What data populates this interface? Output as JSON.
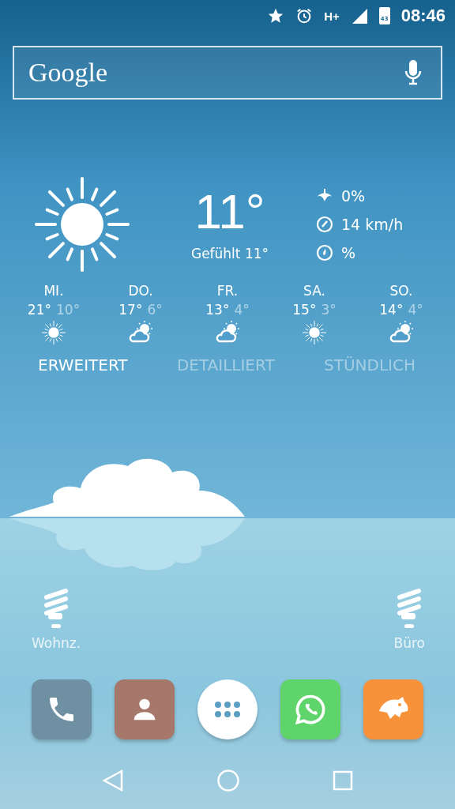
{
  "status_bar": {
    "network": "H+",
    "battery": "43",
    "time": "08:46"
  },
  "search": {
    "logo": "Google"
  },
  "weather": {
    "kind": "sun",
    "temperature": "11°",
    "feels_like": "Gefühlt 11°",
    "details": [
      {
        "kind": "rain",
        "value": "0%"
      },
      {
        "kind": "wind",
        "value": "14 km/h"
      },
      {
        "kind": "humidity",
        "value": "%"
      }
    ]
  },
  "forecast": [
    {
      "day": "MI.",
      "high": "21°",
      "low": "10°",
      "kind": "sun"
    },
    {
      "day": "DO.",
      "high": "17°",
      "low": "6°",
      "kind": "partly-cloudy"
    },
    {
      "day": "FR.",
      "high": "13°",
      "low": "4°",
      "kind": "partly-cloudy"
    },
    {
      "day": "SA.",
      "high": "15°",
      "low": "3°",
      "kind": "sun"
    },
    {
      "day": "SO.",
      "high": "14°",
      "low": "4°",
      "kind": "partly-cloudy"
    }
  ],
  "tabs": [
    {
      "label": "ERWEITERT",
      "selected": true
    },
    {
      "label": "DETAILLIERT",
      "selected": false
    },
    {
      "label": "STÜNDLICH",
      "selected": false
    }
  ],
  "shortcuts": [
    {
      "label": "Wohnz."
    },
    {
      "label": "Büro"
    }
  ],
  "dock": [
    {
      "kind": "phone",
      "color": "#6f8fa3"
    },
    {
      "kind": "contacts",
      "color": "#a5786b"
    },
    {
      "kind": "apps",
      "color": "#ffffff"
    },
    {
      "kind": "chat",
      "color": "#5fd46a"
    },
    {
      "kind": "panther",
      "color": "#f7923a"
    }
  ]
}
